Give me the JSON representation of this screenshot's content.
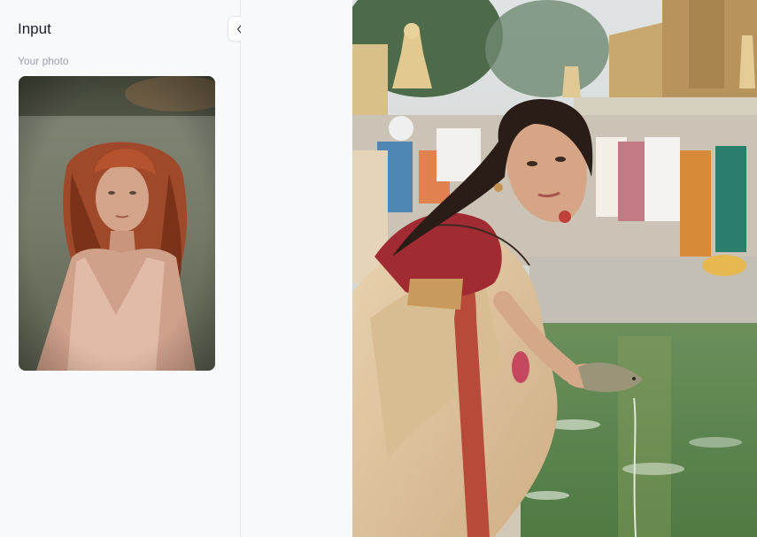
{
  "sidebar": {
    "title": "Input",
    "collapse_icon": "double-chevron-left-icon",
    "section_label": "Your photo"
  },
  "colors": {
    "sidebar_bg": "#f8f9fb",
    "divider": "#e6e8ec",
    "title_text": "#1b1f27",
    "label_text": "#9aa0aa"
  }
}
